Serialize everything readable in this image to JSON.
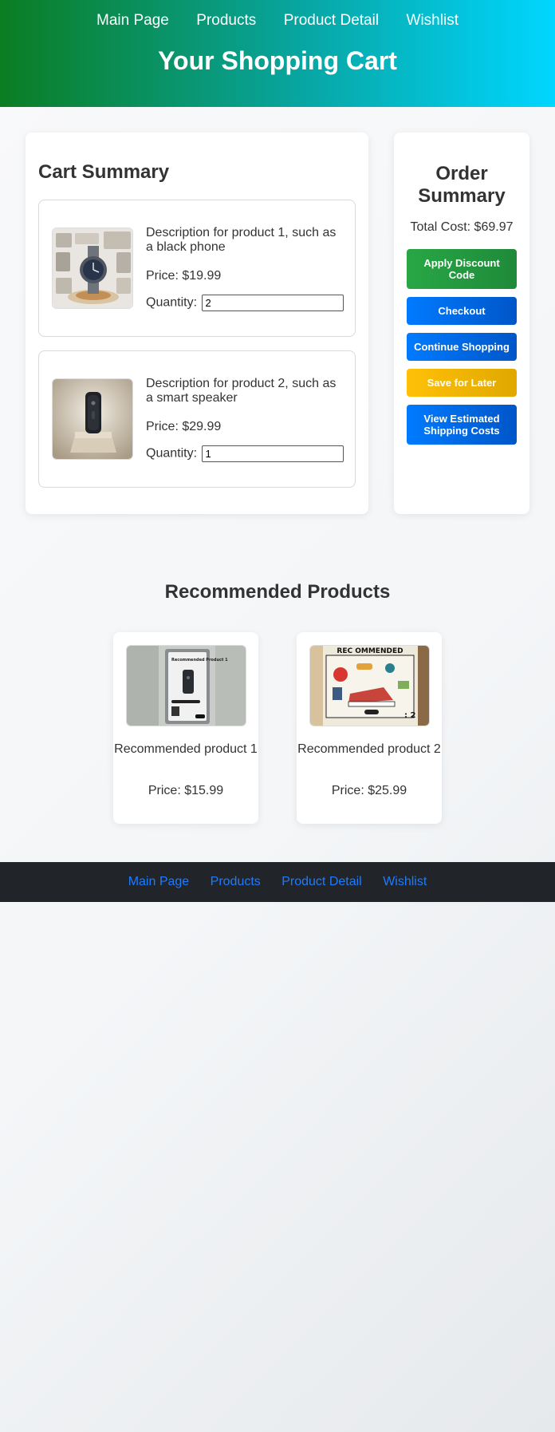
{
  "header": {
    "nav": [
      "Main Page",
      "Products",
      "Product Detail",
      "Wishlist"
    ],
    "title": "Your Shopping Cart"
  },
  "cart": {
    "title": "Cart Summary",
    "items": [
      {
        "description": "Description for product 1, such as a black phone",
        "price": "Price: $19.99",
        "quantity_label": "Quantity:",
        "quantity": "2",
        "image_icon": "smartwatch-collage-image"
      },
      {
        "description": "Description for product 2, such as a smart speaker",
        "price": "Price: $29.99",
        "quantity_label": "Quantity:",
        "quantity": "1",
        "image_icon": "smart-speaker-image"
      }
    ]
  },
  "order": {
    "title": "Order Summary",
    "total": "Total Cost: $69.97",
    "buttons": {
      "discount": "Apply Discount Code",
      "checkout": "Checkout",
      "continue": "Continue Shopping",
      "save": "Save for Later",
      "shipping": "View Estimated Shipping Costs"
    }
  },
  "recommended": {
    "title": "Recommended Products",
    "items": [
      {
        "name": "Recommended product 1",
        "price": "Price: $15.99",
        "image_text": "Recommended Product 1"
      },
      {
        "name": "Recommended product 2",
        "price": "Price: $25.99",
        "image_text": "REC OMMENDED"
      }
    ]
  },
  "footer": {
    "nav": [
      "Main Page",
      "Products",
      "Product Detail",
      "Wishlist"
    ]
  },
  "colors": {
    "header_start": "#0b7d22",
    "header_end": "#00d6ff",
    "green_button": "#28a745",
    "blue_button": "#007bff",
    "yellow_button": "#ffc107",
    "footer_bg": "#212529",
    "footer_link": "#1e7bff"
  }
}
